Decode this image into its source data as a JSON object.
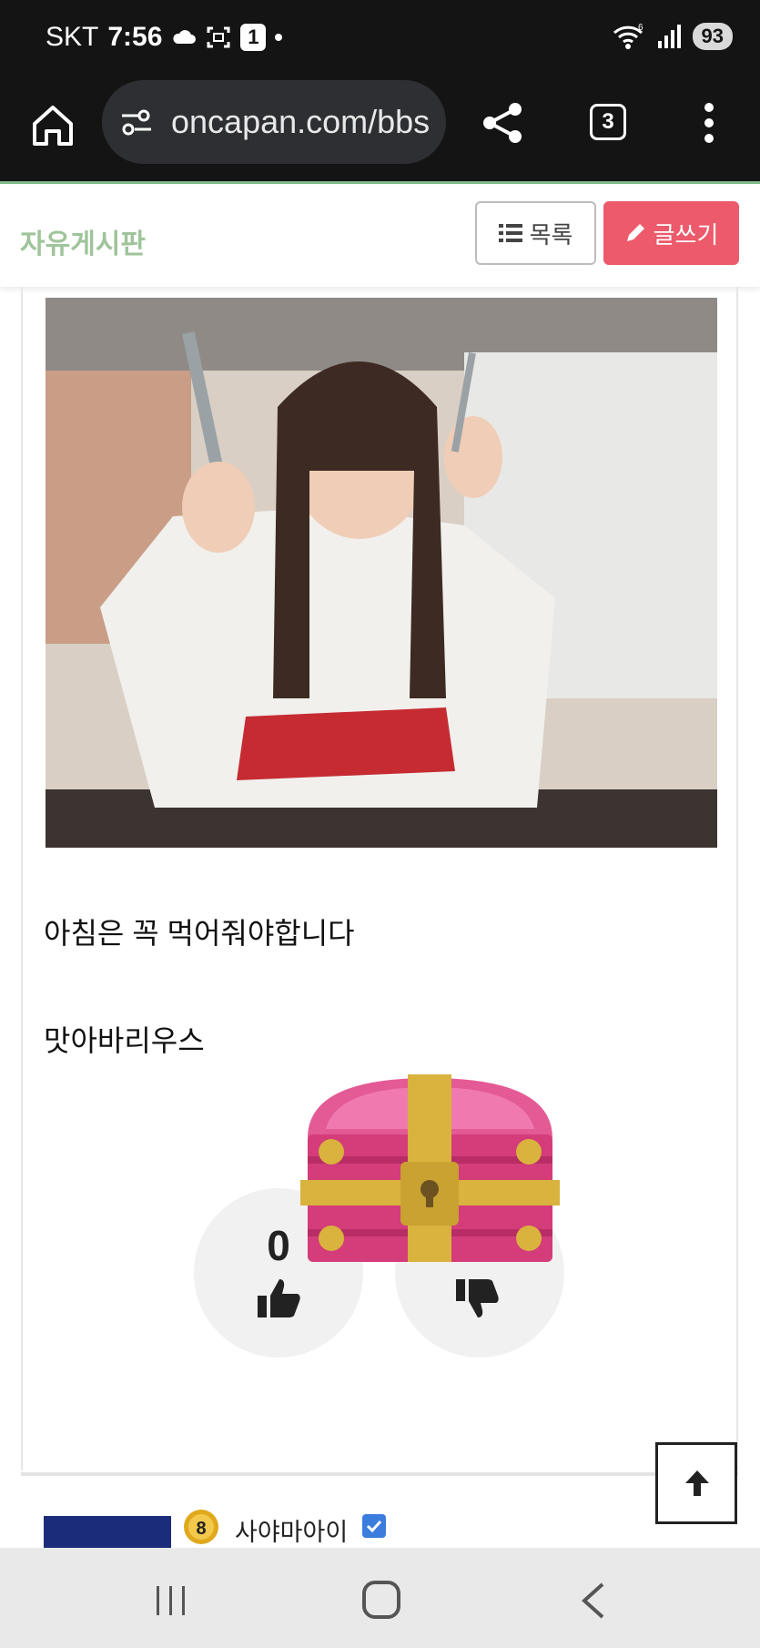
{
  "status_bar": {
    "carrier": "SKT",
    "time": "7:56",
    "notification_count": "1",
    "wifi_badge": "6",
    "battery": "93"
  },
  "browser": {
    "url": "oncapan.com/bbs",
    "tab_count": "3"
  },
  "board": {
    "title": "자유게시판",
    "list_label": "목록",
    "write_label": "글쓰기"
  },
  "post": {
    "line1": "아침은 꼭 먹어줘야합니다",
    "line2": "맛아바리우스",
    "upvotes": "0"
  },
  "comment": {
    "level": "8",
    "author": "사야마아이"
  },
  "colors": {
    "accent_green": "#9fc49b",
    "write_button": "#ec5a6c",
    "chest_pink": "#d43c7a",
    "chest_gold": "#d9b33d"
  }
}
